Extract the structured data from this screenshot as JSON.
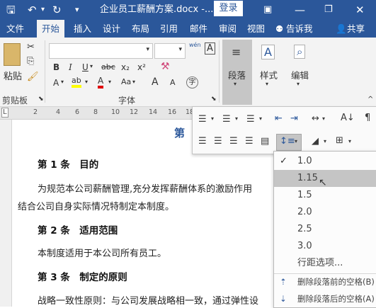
{
  "titlebar": {
    "save_icon": "save-icon",
    "undo_icon": "undo-icon",
    "redo_icon": "redo-icon",
    "title": "企业员工薪酬方案.docx -...",
    "login": "登录",
    "bg": "#2b579a"
  },
  "tabs": [
    "文件",
    "开始",
    "插入",
    "设计",
    "布局",
    "引用",
    "邮件",
    "审阅",
    "视图"
  ],
  "tell_me": "告诉我",
  "share": "共享",
  "ribbon": {
    "clipboard": {
      "paste": "粘贴",
      "label": "剪贴板"
    },
    "font": {
      "label": "字体",
      "bold": "B",
      "italic": "I",
      "underline": "U",
      "strike": "abc",
      "sub": "x₂",
      "sup": "x²",
      "wen": "wén",
      "A_box": "A",
      "grow": "A",
      "shrink": "A",
      "aa": "Aa",
      "zi": "字"
    },
    "paragraph": {
      "label": "段落"
    },
    "styles": {
      "label": "样式"
    },
    "editing": {
      "label": "编辑"
    }
  },
  "ruler": {
    "ticks": [
      "2",
      "4",
      "6",
      "8",
      "10",
      "12",
      "14",
      "16",
      "18",
      "20",
      "22",
      "24",
      "26",
      "28",
      "30",
      "32"
    ]
  },
  "doc": {
    "title_fragment": "第",
    "heading1": "第 1 条　目的",
    "para1_line1": "为规范本公司薪酬管理,充分发挥薪酬体系的激励作用",
    "para1_line2": "结合公司自身实际情况特制定本制度。",
    "heading2": "第 2 条　适用范围",
    "para2": "本制度适用于本公司所有员工。",
    "heading3": "第 3 条　制定的原则",
    "para3": "战略一致性原则：与公司发展战略相一致，通过弹性设"
  },
  "spacing_menu": {
    "options": [
      "1.0",
      "1.15",
      "1.5",
      "2.0",
      "2.5",
      "3.0"
    ],
    "selected": "1.0",
    "hover": "1.15",
    "line_options": "行距选项...",
    "remove_before": "删除段落前的空格(B)",
    "remove_after": "删除段落后的空格(A)"
  }
}
